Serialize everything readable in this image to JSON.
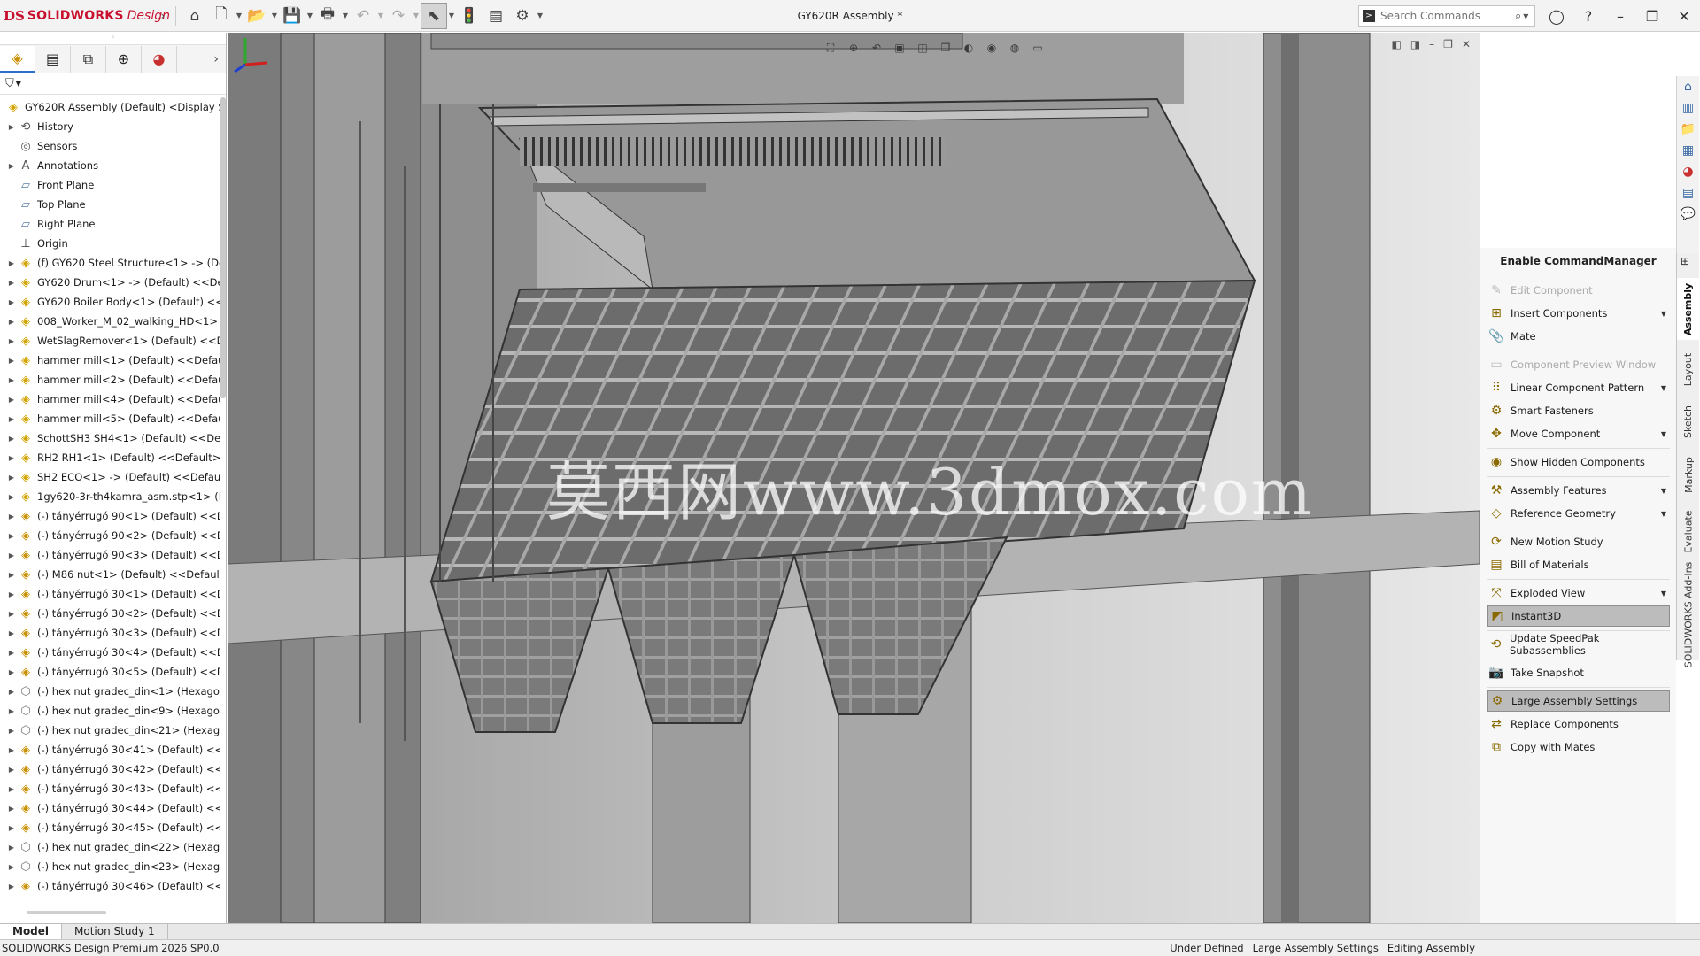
{
  "app": {
    "brand": "SOLIDWORKS",
    "brand_suffix": "Design",
    "logo_mark": "DS",
    "doc_title": "GY620R Assembly *"
  },
  "search": {
    "placeholder": "Search Commands"
  },
  "toolbar": {
    "icons": [
      "chevron-right-icon",
      "home-icon",
      "new-document-icon",
      "open-folder-icon",
      "save-icon",
      "print-icon",
      "undo-icon",
      "redo-icon",
      "select-cursor-icon",
      "rebuild-icon",
      "file-properties-icon",
      "options-gear-icon"
    ]
  },
  "panel": {
    "tabs": [
      "feature-manager-icon",
      "property-manager-icon",
      "configuration-manager-icon",
      "dimxpert-icon",
      "display-manager-icon"
    ]
  },
  "tree": {
    "root": "GY620R Assembly (Default) <Display Sta",
    "items": [
      {
        "label": "History",
        "icon": "history",
        "exp": true
      },
      {
        "label": "Sensors",
        "icon": "sensor",
        "exp": false
      },
      {
        "label": "Annotations",
        "icon": "annotation",
        "exp": true
      },
      {
        "label": "Front Plane",
        "icon": "plane",
        "exp": false
      },
      {
        "label": "Top Plane",
        "icon": "plane",
        "exp": false
      },
      {
        "label": "Right Plane",
        "icon": "plane",
        "exp": false
      },
      {
        "label": "Origin",
        "icon": "origin",
        "exp": false
      },
      {
        "label": "(f) GY620 Steel Structure<1> -> (Def",
        "icon": "assy",
        "exp": true
      },
      {
        "label": "GY620 Drum<1> -> (Default) <<Def",
        "icon": "assy",
        "exp": true
      },
      {
        "label": "GY620 Boiler Body<1> (Default) <<I",
        "icon": "assy",
        "exp": true
      },
      {
        "label": "008_Worker_M_02_walking_HD<1>",
        "icon": "assy",
        "exp": true
      },
      {
        "label": "WetSlagRemover<1> (Default) <<D",
        "icon": "assy",
        "exp": true
      },
      {
        "label": "hammer mill<1> (Default) <<Defau",
        "icon": "assy",
        "exp": true
      },
      {
        "label": "hammer mill<2> (Default) <<Defau",
        "icon": "assy",
        "exp": true
      },
      {
        "label": "hammer mill<4> (Default) <<Defau",
        "icon": "assy",
        "exp": true
      },
      {
        "label": "hammer mill<5> (Default) <<Defau",
        "icon": "assy",
        "exp": true
      },
      {
        "label": "SchottSH3 SH4<1> (Default) <<Def",
        "icon": "assy",
        "exp": true
      },
      {
        "label": "RH2 RH1<1> (Default) <<Default>_",
        "icon": "assy",
        "exp": true
      },
      {
        "label": "SH2 ECO<1> -> (Default) <<Defaul",
        "icon": "assy",
        "exp": true
      },
      {
        "label": "1gy620-3r-th4kamra_asm.stp<1> (D",
        "icon": "assy",
        "exp": true
      },
      {
        "label": "(-) tányérrugó 90<1> (Default) <<D",
        "icon": "part",
        "exp": true
      },
      {
        "label": "(-) tányérrugó 90<2> (Default) <<D",
        "icon": "part",
        "exp": true
      },
      {
        "label": "(-) tányérrugó 90<3> (Default) <<D",
        "icon": "part",
        "exp": true
      },
      {
        "label": "(-) M86 nut<1> (Default) <<Default",
        "icon": "part",
        "exp": true
      },
      {
        "label": "(-) tányérrugó 30<1> (Default) <<D",
        "icon": "part",
        "exp": true
      },
      {
        "label": "(-) tányérrugó 30<2> (Default) <<D",
        "icon": "part",
        "exp": true
      },
      {
        "label": "(-) tányérrugó 30<3> (Default) <<D",
        "icon": "part",
        "exp": true
      },
      {
        "label": "(-) tányérrugó 30<4> (Default) <<D",
        "icon": "part",
        "exp": true
      },
      {
        "label": "(-) tányérrugó 30<5> (Default) <<D",
        "icon": "part",
        "exp": true
      },
      {
        "label": "(-) hex nut gradec_din<1> (Hexagor",
        "icon": "nut",
        "exp": true
      },
      {
        "label": "(-) hex nut gradec_din<9> (Hexagor",
        "icon": "nut",
        "exp": true
      },
      {
        "label": "(-) hex nut gradec_din<21> (Hexagc",
        "icon": "nut",
        "exp": true
      },
      {
        "label": "(-) tányérrugó 30<41> (Default) <<I",
        "icon": "part",
        "exp": true
      },
      {
        "label": "(-) tányérrugó 30<42> (Default) <<I",
        "icon": "part",
        "exp": true
      },
      {
        "label": "(-) tányérrugó 30<43> (Default) <<I",
        "icon": "part",
        "exp": true
      },
      {
        "label": "(-) tányérrugó 30<44> (Default) <<I",
        "icon": "part",
        "exp": true
      },
      {
        "label": "(-) tányérrugó 30<45> (Default) <<I",
        "icon": "part",
        "exp": true
      },
      {
        "label": "(-) hex nut gradec_din<22> (Hexagc",
        "icon": "nut",
        "exp": true
      },
      {
        "label": "(-) hex nut gradec_din<23> (Hexagc",
        "icon": "nut",
        "exp": true
      },
      {
        "label": "(-) tányérrugó 30<46> (Default) <<I",
        "icon": "part",
        "exp": true
      }
    ]
  },
  "viewport": {
    "watermark": "莫西网www.3dmox.com"
  },
  "cmdmgr": {
    "title": "Enable CommandManager",
    "commands": [
      {
        "label": "Edit Component",
        "disabled": true,
        "highlight": false,
        "caret": false,
        "icon": "edit-component-icon"
      },
      {
        "label": "Insert Components",
        "disabled": false,
        "highlight": false,
        "caret": true,
        "icon": "insert-components-icon"
      },
      {
        "label": "Mate",
        "disabled": false,
        "highlight": false,
        "caret": false,
        "icon": "mate-icon"
      },
      {
        "label": "Component Preview Window",
        "disabled": true,
        "highlight": false,
        "caret": false,
        "icon": "preview-window-icon"
      },
      {
        "label": "Linear Component Pattern",
        "disabled": false,
        "highlight": false,
        "caret": true,
        "icon": "linear-pattern-icon"
      },
      {
        "label": "Smart Fasteners",
        "disabled": false,
        "highlight": false,
        "caret": false,
        "icon": "smart-fasteners-icon"
      },
      {
        "label": "Move Component",
        "disabled": false,
        "highlight": false,
        "caret": true,
        "icon": "move-component-icon"
      },
      {
        "label": "Show Hidden Components",
        "disabled": false,
        "highlight": false,
        "caret": false,
        "icon": "show-hidden-icon"
      },
      {
        "label": "Assembly Features",
        "disabled": false,
        "highlight": false,
        "caret": true,
        "icon": "assembly-features-icon"
      },
      {
        "label": "Reference Geometry",
        "disabled": false,
        "highlight": false,
        "caret": true,
        "icon": "reference-geometry-icon"
      },
      {
        "label": "New Motion Study",
        "disabled": false,
        "highlight": false,
        "caret": false,
        "icon": "motion-study-icon"
      },
      {
        "label": "Bill of Materials",
        "disabled": false,
        "highlight": false,
        "caret": false,
        "icon": "bom-icon"
      },
      {
        "label": "Exploded View",
        "disabled": false,
        "highlight": false,
        "caret": true,
        "icon": "exploded-view-icon"
      },
      {
        "label": "Instant3D",
        "disabled": false,
        "highlight": true,
        "caret": false,
        "icon": "instant3d-icon"
      },
      {
        "label": "Update SpeedPak Subassemblies",
        "disabled": false,
        "highlight": false,
        "caret": false,
        "icon": "speedpak-icon"
      },
      {
        "label": "Take Snapshot",
        "disabled": false,
        "highlight": false,
        "caret": false,
        "icon": "snapshot-icon"
      },
      {
        "label": "Large Assembly Settings",
        "disabled": false,
        "highlight": true,
        "caret": false,
        "icon": "large-assembly-icon"
      },
      {
        "label": "Replace Components",
        "disabled": false,
        "highlight": false,
        "caret": false,
        "icon": "replace-components-icon"
      },
      {
        "label": "Copy with Mates",
        "disabled": false,
        "highlight": false,
        "caret": false,
        "icon": "copy-with-mates-icon"
      }
    ],
    "tabs": [
      "Assembly",
      "Layout",
      "Sketch",
      "Markup",
      "Evaluate",
      "SOLIDWORKS Add-Ins"
    ]
  },
  "bottom_tabs": [
    "Model",
    "Motion Study 1"
  ],
  "status": {
    "left": "SOLIDWORKS Design Premium 2026 SP0.0",
    "items": [
      "Under Defined",
      "Large Assembly Settings",
      "Editing Assembly"
    ]
  },
  "colors": {
    "brand": "#c8102e",
    "highlight": "#bcbcbc",
    "viewport_bg": "#c8c8c8"
  }
}
